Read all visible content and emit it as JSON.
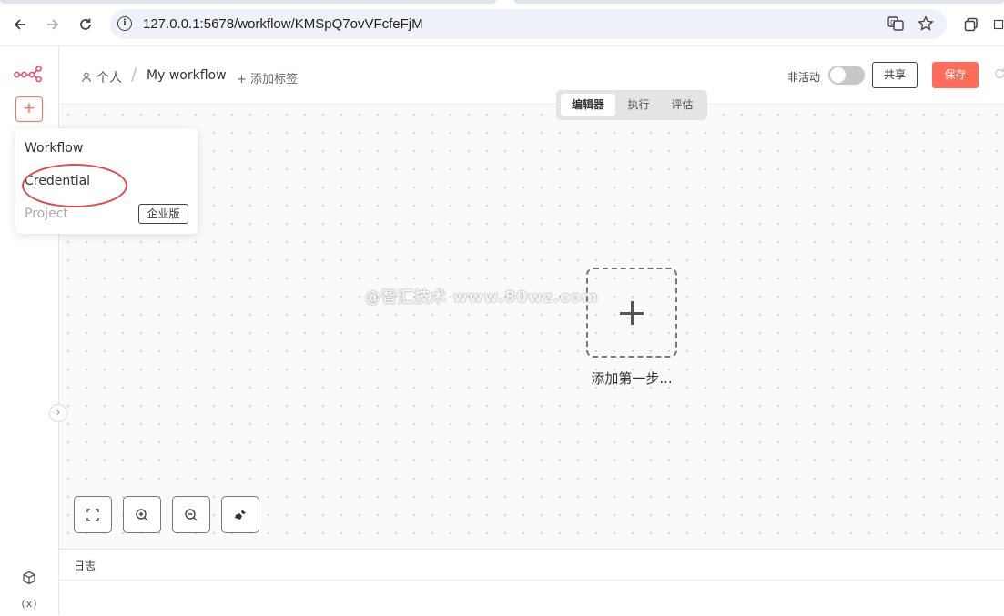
{
  "browser": {
    "url": "127.0.0.1:5678/workflow/KMSpQ7ovVFcfeFjM"
  },
  "header": {
    "owner_label": "个人",
    "separator": "/",
    "workflow_name": "My workflow",
    "add_tag_label": "+ 添加标签",
    "active_label": "非活动",
    "active": false,
    "share_label": "共享",
    "save_label": "保存"
  },
  "mode_tabs": [
    {
      "label": "编辑器",
      "active": true
    },
    {
      "label": "执行",
      "active": false
    },
    {
      "label": "评估",
      "active": false
    }
  ],
  "add_menu": {
    "items": [
      {
        "label": "Workflow",
        "enabled": true
      },
      {
        "label": "Credential",
        "enabled": true,
        "highlighted": true
      },
      {
        "label": "Project",
        "enabled": false,
        "badge": "企业版"
      }
    ]
  },
  "canvas": {
    "add_first_step_label": "添加第一步...",
    "watermark": "@智汇技术 www.80wz.com"
  },
  "sidebar": {
    "add_symbol": "+",
    "bottom_icons": [
      "cube-icon",
      "variables-icon"
    ],
    "variables_text": "(x)"
  },
  "log_panel": {
    "title": "日志"
  },
  "colors": {
    "accent": "#ff6d5a",
    "highlight_ring": "#e24a4a"
  }
}
